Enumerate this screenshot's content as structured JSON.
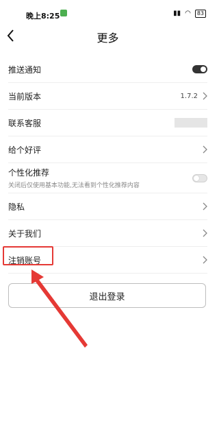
{
  "status_bar": {
    "time": "晚上8:25",
    "battery": "83",
    "signal_icon": "signal-icon",
    "wifi_icon": "wifi-icon"
  },
  "header": {
    "title": "更多",
    "back_icon": "chevron-left-icon"
  },
  "settings": {
    "push_notification": {
      "label": "推送通知",
      "enabled": true
    },
    "current_version": {
      "label": "当前版本",
      "value": "1.7.2"
    },
    "customer_service": {
      "label": "联系客服"
    },
    "rate_us": {
      "label": "给个好评"
    },
    "personalized": {
      "label": "个性化推荐",
      "description": "关闭后仅使用基本功能,无法看到个性化推荐内容",
      "enabled": false
    },
    "privacy": {
      "label": "隐私"
    },
    "about_us": {
      "label": "关于我们"
    },
    "cancel_account": {
      "label": "注销账号"
    }
  },
  "logout_button": {
    "label": "退出登录"
  },
  "colors": {
    "accent_annotation": "#e53935",
    "toggle_on": "#333333",
    "divider": "#eeeeee"
  }
}
